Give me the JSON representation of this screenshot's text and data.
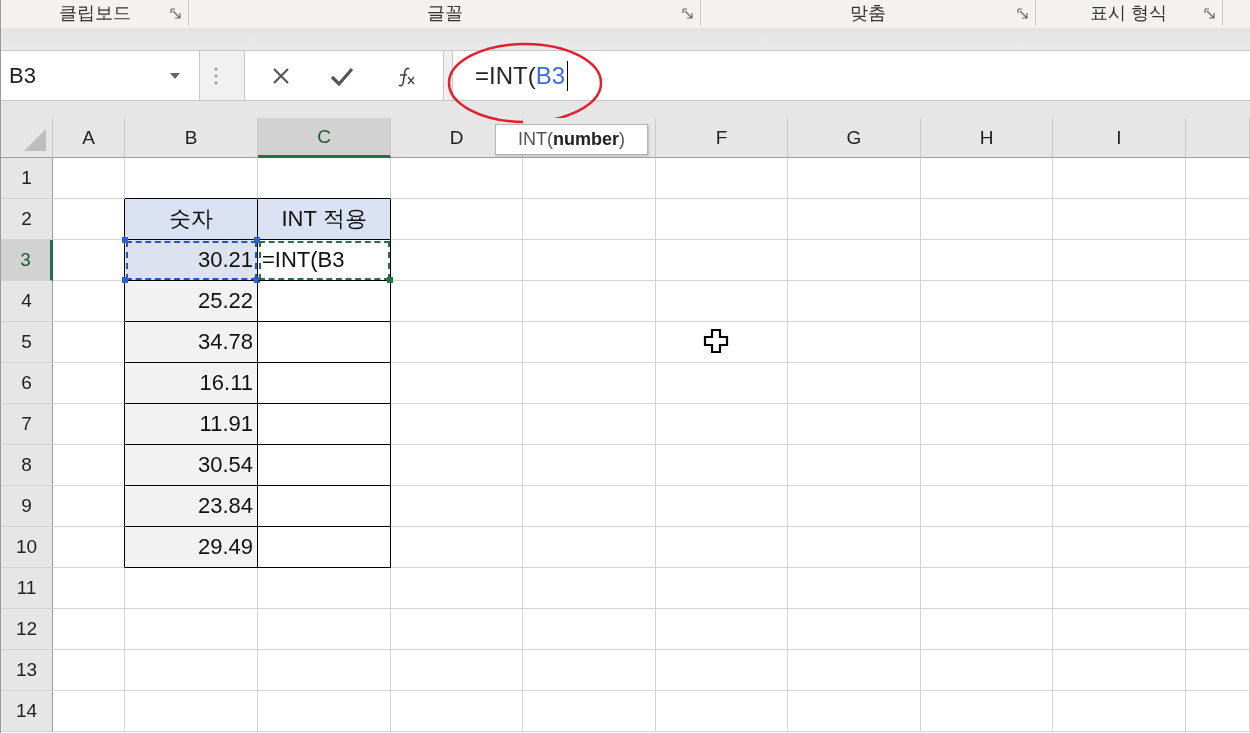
{
  "ribbon": {
    "groups": [
      {
        "label": "클립보드"
      },
      {
        "label": "글꼴"
      },
      {
        "label": "맞춤"
      },
      {
        "label": "표시 형식"
      }
    ]
  },
  "formula_bar": {
    "name_box": "B3",
    "formula_parts": [
      {
        "text": "=INT(",
        "color": "#262626"
      },
      {
        "text": "B3",
        "color": "#3a6fd8"
      }
    ]
  },
  "columns": [
    {
      "kind": "header",
      "label": "A",
      "selected": false
    },
    {
      "kind": "header",
      "label": "B",
      "selected": false
    },
    {
      "kind": "header",
      "label": "C",
      "selected": true
    },
    {
      "kind": "header",
      "label": "D",
      "selected": false
    },
    {
      "kind": "tooltip",
      "text": "INT(**number**)"
    },
    {
      "kind": "header",
      "label": "F",
      "selected": false
    },
    {
      "kind": "header",
      "label": "G",
      "selected": false
    },
    {
      "kind": "header",
      "label": "H",
      "selected": false
    },
    {
      "kind": "header",
      "label": "I",
      "selected": false
    }
  ],
  "rows": [
    {
      "label": "1",
      "selected": false
    },
    {
      "label": "2",
      "selected": false
    },
    {
      "label": "3",
      "selected": true
    },
    {
      "label": "4",
      "selected": false
    },
    {
      "label": "5",
      "selected": false
    },
    {
      "label": "6",
      "selected": false
    },
    {
      "label": "7",
      "selected": false
    },
    {
      "label": "8",
      "selected": false
    },
    {
      "label": "9",
      "selected": false
    },
    {
      "label": "10",
      "selected": false
    },
    {
      "label": "11",
      "selected": false
    },
    {
      "label": "12",
      "selected": false
    },
    {
      "label": "13",
      "selected": false
    },
    {
      "label": "14",
      "selected": false
    }
  ],
  "table": {
    "header": [
      "숫자",
      "INT 적용"
    ],
    "rows": [
      {
        "number": "30.21",
        "referenced": true,
        "result": "=INT(B3",
        "editing": true
      },
      {
        "number": "25.22",
        "referenced": false,
        "editing": false
      },
      {
        "number": "34.78",
        "referenced": false,
        "editing": false
      },
      {
        "number": "16.11",
        "referenced": false,
        "editing": false
      },
      {
        "number": "11.91",
        "referenced": false,
        "editing": false
      },
      {
        "number": "30.54",
        "referenced": false,
        "editing": false
      },
      {
        "number": "23.84",
        "referenced": false,
        "editing": false
      },
      {
        "number": "29.49",
        "referenced": false,
        "editing": false
      }
    ]
  }
}
